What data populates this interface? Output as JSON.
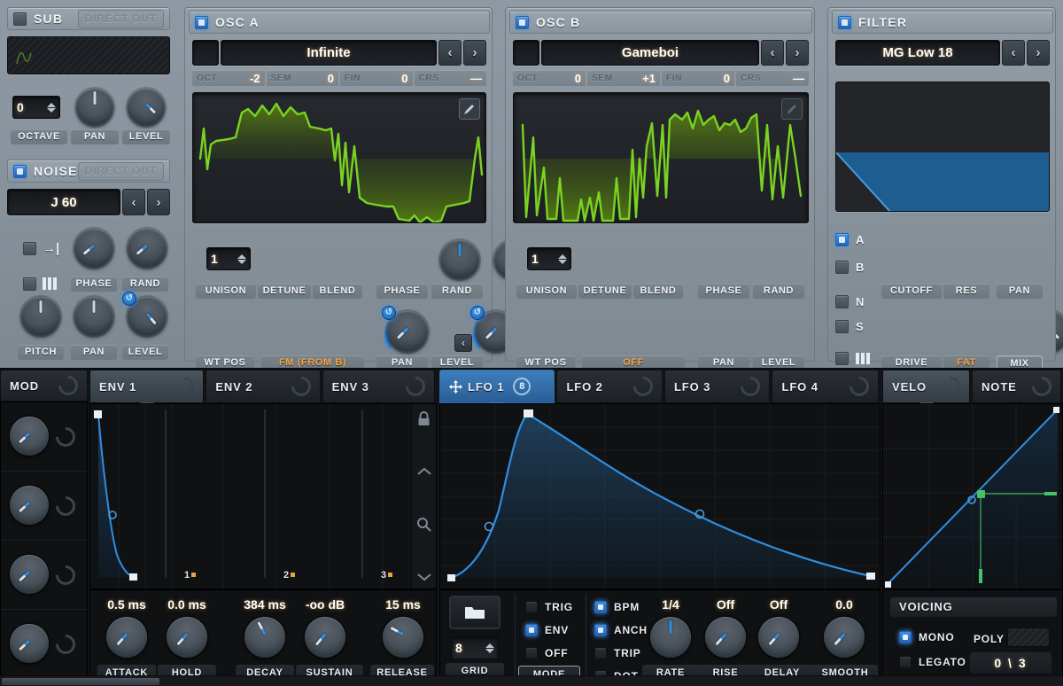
{
  "sub": {
    "title": "SUB",
    "enabled": false,
    "direct_out": "DIRECT OUT",
    "octave_value": "0",
    "labels": {
      "octave": "OCTAVE",
      "pan": "PAN",
      "level": "LEVEL"
    }
  },
  "noise": {
    "title": "NOISE",
    "enabled": true,
    "direct_out": "DIRECT OUT",
    "preset": "J 60",
    "prev": "‹",
    "next": "›",
    "labels": {
      "phase": "PHASE",
      "rand": "RAND",
      "pitch": "PITCH",
      "pan": "PAN",
      "level": "LEVEL"
    }
  },
  "osc_a": {
    "title": "OSC  A",
    "enabled": true,
    "wavetable": "Infinite",
    "prev": "‹",
    "next": "›",
    "tune": [
      {
        "key": "OCT",
        "value": "-2"
      },
      {
        "key": "SEM",
        "value": "0"
      },
      {
        "key": "FIN",
        "value": "0"
      },
      {
        "key": "CRS",
        "value": "—"
      }
    ],
    "unison_value": "1",
    "labels": {
      "unison": "UNISON",
      "detune": "DETUNE",
      "blend": "BLEND",
      "phase": "PHASE",
      "rand": "RAND",
      "wtpos": "WT POS",
      "fm": "FM (FROM B)",
      "pan": "PAN",
      "level": "LEVEL"
    },
    "fm_prev": "‹",
    "fm_next": "›"
  },
  "osc_b": {
    "title": "OSC  B",
    "enabled": true,
    "wavetable": "Gameboi",
    "prev": "‹",
    "next": "›",
    "tune": [
      {
        "key": "OCT",
        "value": "0"
      },
      {
        "key": "SEM",
        "value": "+1"
      },
      {
        "key": "FIN",
        "value": "0"
      },
      {
        "key": "CRS",
        "value": "—"
      }
    ],
    "unison_value": "1",
    "labels": {
      "unison": "UNISON",
      "detune": "DETUNE",
      "blend": "BLEND",
      "phase": "PHASE",
      "rand": "RAND",
      "wtpos": "WT POS",
      "fm": "OFF",
      "pan": "PAN",
      "level": "LEVEL"
    },
    "fm_prev": "‹",
    "fm_next": "›"
  },
  "filter": {
    "title": "FILTER",
    "enabled": true,
    "type": "MG Low 18",
    "prev": "‹",
    "next": "›",
    "routing": [
      {
        "name": "A",
        "on": true
      },
      {
        "name": "B",
        "on": false
      },
      {
        "name": "N",
        "on": false
      },
      {
        "name": "S",
        "on": false
      },
      {
        "name": "keys",
        "on": false
      }
    ],
    "labels": {
      "cutoff": "CUTOFF",
      "res": "RES",
      "pan": "PAN",
      "drive": "DRIVE",
      "fat": "FAT",
      "mix": "MIX"
    }
  },
  "mod_matrix": {
    "title": "MOD"
  },
  "env_tabs": [
    {
      "label": "ENV 1",
      "selected": true
    },
    {
      "label": "ENV 2",
      "selected": false
    },
    {
      "label": "ENV 3",
      "selected": false
    }
  ],
  "lfo_tabs": [
    {
      "label": "LFO 1",
      "selected": true,
      "badge": "8"
    },
    {
      "label": "LFO 2",
      "selected": false
    },
    {
      "label": "LFO 3",
      "selected": false
    },
    {
      "label": "LFO 4",
      "selected": false
    }
  ],
  "right_tabs": [
    {
      "label": "VELO",
      "selected": true
    },
    {
      "label": "NOTE",
      "selected": false
    }
  ],
  "env_graph": {
    "markers": [
      "1",
      "2",
      "3"
    ],
    "side_icons": [
      "lock-icon",
      "chevron-up-icon",
      "zoom-icon",
      "chevron-down-icon"
    ]
  },
  "env_controls": [
    {
      "label": "ATTACK",
      "value": "0.5 ms"
    },
    {
      "label": "HOLD",
      "value": "0.0 ms"
    },
    {
      "label": "DECAY",
      "value": "384 ms"
    },
    {
      "label": "SUSTAIN",
      "value": "-oo dB"
    },
    {
      "label": "RELEASE",
      "value": "15 ms"
    }
  ],
  "lfo_controls": {
    "folder_icon": "folder-icon",
    "grid_value": "8",
    "grid_label": "GRID",
    "mode_label": "MODE",
    "mode_options": [
      {
        "label": "TRIG",
        "on": false
      },
      {
        "label": "ENV",
        "on": true
      },
      {
        "label": "OFF",
        "on": false
      }
    ],
    "sync_options": [
      {
        "label": "BPM",
        "on": true
      },
      {
        "label": "ANCH",
        "on": true
      },
      {
        "label": "TRIP",
        "on": false
      },
      {
        "label": "DOT",
        "on": false
      }
    ],
    "knobs": [
      {
        "label": "RATE",
        "value": "1/4"
      },
      {
        "label": "RISE",
        "value": "Off"
      },
      {
        "label": "DELAY",
        "value": "Off"
      },
      {
        "label": "SMOOTH",
        "value": "0.0"
      }
    ]
  },
  "voicing": {
    "title": "VOICING",
    "mono_label": "MONO",
    "mono_on": true,
    "legato_label": "LEGATO",
    "legato_on": false,
    "poly_label": "POLY",
    "poly_value": "",
    "portamento": "0  \\  3"
  },
  "colors": {
    "accent_blue": "#3f8fe0",
    "wave_green": "#7ad321",
    "value_orange": "#f7a23c",
    "panel_gray": "#8a949e",
    "dark_bg": "#121417"
  },
  "chart_data": [
    {
      "type": "line",
      "name": "osc-a-wavetable",
      "title": "Infinite",
      "x": [
        0,
        0.02,
        0.04,
        0.05,
        0.07,
        0.1,
        0.13,
        0.16,
        0.19,
        0.22,
        0.25,
        0.28,
        0.31,
        0.34,
        0.37,
        0.4,
        0.43,
        0.45,
        0.47,
        0.49,
        0.51,
        0.53,
        0.56,
        0.6,
        0.64,
        0.68,
        0.72,
        0.76,
        0.8,
        0.84,
        0.88,
        0.92,
        0.96,
        1.0
      ],
      "y": [
        0.0,
        0.55,
        -0.1,
        0.35,
        0.4,
        0.42,
        0.85,
        0.78,
        0.9,
        0.8,
        0.92,
        0.82,
        0.9,
        0.45,
        0.42,
        0.4,
        -0.05,
        0.55,
        -0.35,
        0.25,
        -0.55,
        -0.62,
        -0.66,
        -0.7,
        -0.72,
        -0.9,
        -0.82,
        -0.95,
        -0.88,
        -0.7,
        -0.62,
        -0.6,
        0.1,
        0.2
      ],
      "ylim": [
        -1,
        1
      ]
    },
    {
      "type": "line",
      "name": "osc-b-wavetable",
      "title": "Gameboi",
      "x": [
        0,
        0.03,
        0.05,
        0.08,
        0.1,
        0.13,
        0.16,
        0.19,
        0.22,
        0.25,
        0.28,
        0.31,
        0.34,
        0.37,
        0.4,
        0.43,
        0.46,
        0.49,
        0.52,
        0.55,
        0.58,
        0.61,
        0.64,
        0.67,
        0.7,
        0.73,
        0.76,
        0.79,
        0.82,
        0.85,
        0.88,
        0.91,
        0.94,
        0.97,
        1.0
      ],
      "y": [
        0.45,
        -0.95,
        0.35,
        -0.92,
        -0.2,
        -0.95,
        -0.55,
        -0.9,
        -0.7,
        -0.95,
        -0.6,
        -0.92,
        -0.55,
        -0.9,
        0.2,
        -0.55,
        0.3,
        -0.7,
        0.75,
        -0.45,
        0.8,
        0.3,
        0.92,
        0.45,
        0.95,
        0.7,
        0.85,
        0.72,
        0.95,
        0.4,
        0.9,
        -0.3,
        0.55,
        -0.6,
        0.2
      ],
      "ylim": [
        -1,
        1
      ]
    },
    {
      "type": "line",
      "name": "filter-response",
      "title": "MG Low 18",
      "x": [
        0,
        0.03,
        0.3
      ],
      "y": [
        0.55,
        0.52,
        -0.05
      ],
      "ylim": [
        0,
        1
      ]
    },
    {
      "type": "area",
      "name": "env-1-curve",
      "title": "ENV 1",
      "x": [
        0.0,
        0.02,
        0.04,
        0.07,
        0.1,
        0.13,
        0.16,
        0.2,
        0.24,
        0.28,
        0.33
      ],
      "y": [
        1.0,
        0.8,
        0.62,
        0.45,
        0.33,
        0.22,
        0.14,
        0.08,
        0.04,
        0.01,
        0.0
      ],
      "xlabel": "",
      "ylabel": "",
      "ylim": [
        0,
        1
      ],
      "markers": [
        "1",
        "2",
        "3"
      ]
    },
    {
      "type": "area",
      "name": "lfo-1-curve",
      "title": "LFO 1",
      "x": [
        0.0,
        0.025,
        0.05,
        0.075,
        0.1,
        0.125,
        0.2,
        0.3,
        0.4,
        0.5,
        0.6,
        0.7,
        0.8,
        0.9,
        1.0
      ],
      "y": [
        0.0,
        0.11,
        0.25,
        0.52,
        0.8,
        1.0,
        0.87,
        0.72,
        0.6,
        0.49,
        0.39,
        0.3,
        0.21,
        0.11,
        0.01
      ],
      "ylim": [
        0,
        1
      ]
    },
    {
      "type": "line",
      "name": "velocity-curve",
      "title": "VELO",
      "x": [
        0,
        1
      ],
      "y": [
        0,
        1
      ],
      "ylim": [
        0,
        1
      ],
      "annotations": [
        "node at x=0.5, y=0.52"
      ]
    }
  ]
}
